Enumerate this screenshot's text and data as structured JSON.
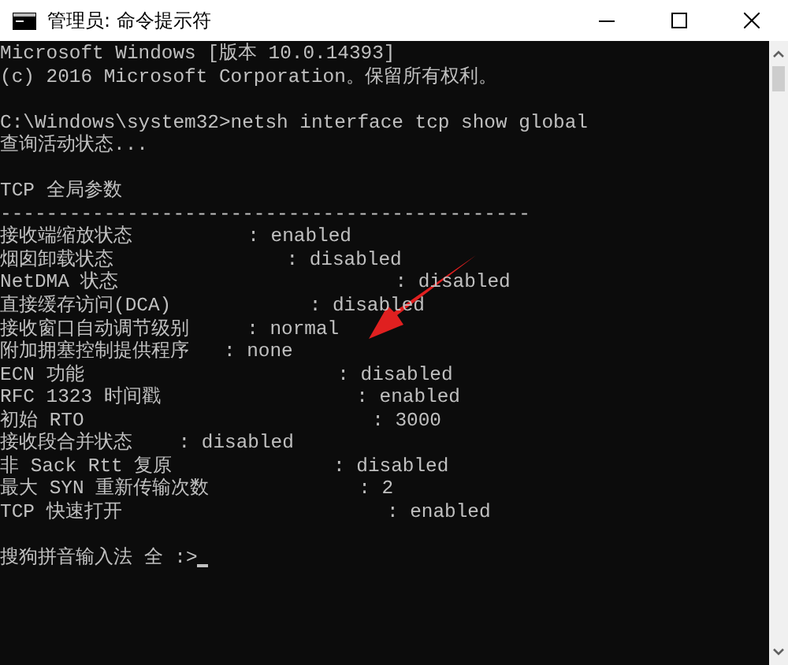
{
  "window": {
    "title": "管理员: 命令提示符"
  },
  "console": {
    "blocks": [
      [
        "Microsoft Windows [版本 10.0.14393]",
        "(c) 2016 Microsoft Corporation。保留所有权利。"
      ],
      [
        "C:\\Windows\\system32>netsh interface tcp show global",
        "查询活动状态..."
      ],
      [
        "TCP 全局参数",
        "----------------------------------------------",
        "接收端缩放状态          : enabled",
        "烟囱卸载状态               : disabled",
        "NetDMA 状态                        : disabled",
        "直接缓存访问(DCA)            : disabled",
        "接收窗口自动调节级别     : normal",
        "附加拥塞控制提供程序   : none",
        "ECN 功能                      : disabled",
        "RFC 1323 时间戳                 : enabled",
        "初始 RTO                         : 3000",
        "接收段合并状态    : disabled",
        "非 Sack Rtt 复原              : disabled",
        "最大 SYN 重新传输次数             : 2",
        "TCP 快速打开                       : enabled"
      ]
    ],
    "prompt": "搜狗拼音输入法 全 :>"
  }
}
